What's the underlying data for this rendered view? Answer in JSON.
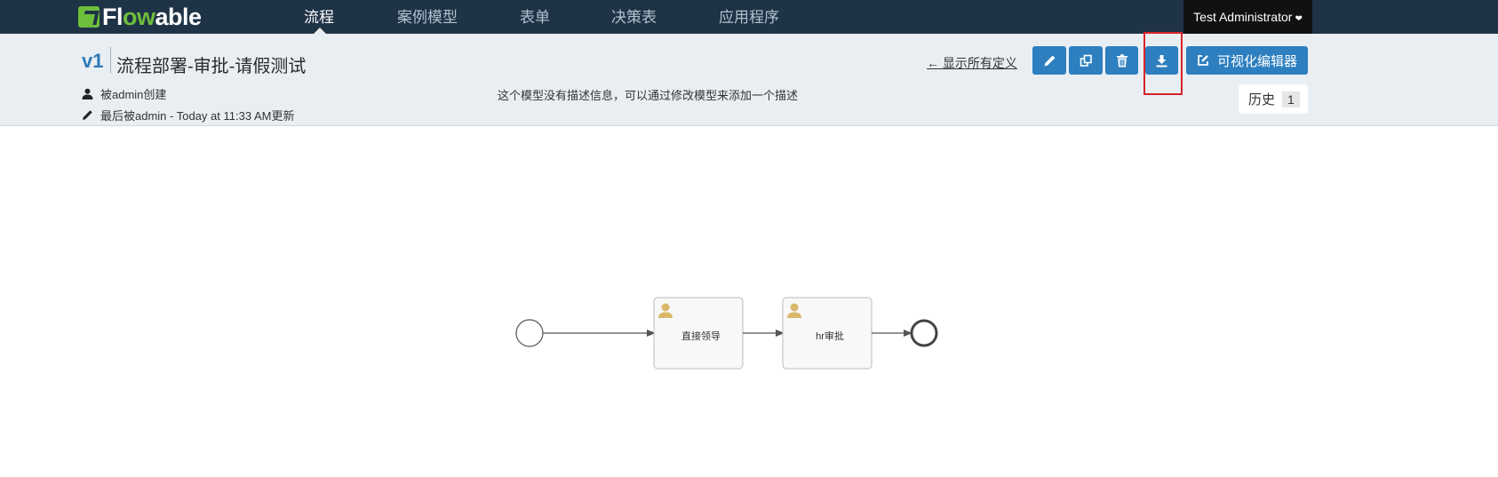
{
  "navbar": {
    "logo_text_a": "Fl",
    "logo_text_b": "ow",
    "logo_text_c": "able",
    "items": [
      {
        "label": "流程",
        "active": true
      },
      {
        "label": "案例模型",
        "active": false
      },
      {
        "label": "表单",
        "active": false
      },
      {
        "label": "决策表",
        "active": false
      },
      {
        "label": "应用程序",
        "active": false
      }
    ],
    "user": "Test Administrator",
    "user_chevron": "chevron-down-icon"
  },
  "header": {
    "version": "v1",
    "title": "流程部署-审批-请假测试",
    "created_by": "被admin创建",
    "updated": "最后被admin - Today at 11:33 AM更新",
    "description": "这个模型没有描述信息，可以通过修改模型来添加一个描述",
    "back_link": "← 显示所有定义",
    "toolbar": {
      "edit_icon": "pencil-icon",
      "copy_icon": "copy-icon",
      "delete_icon": "trash-icon",
      "export_icon": "download-icon",
      "editor_label": "可视化编辑器"
    },
    "history_label": "历史",
    "history_count": "1"
  },
  "diagram": {
    "tasks": [
      {
        "label": "直接领导"
      },
      {
        "label": "hr审批"
      }
    ]
  },
  "colors": {
    "navbar_bg": "#1f3347",
    "brand_green": "#6dbf3b",
    "button_blue": "#2d7fbf",
    "highlight_red": "#d8242a",
    "header_bg": "#e9eef3"
  }
}
